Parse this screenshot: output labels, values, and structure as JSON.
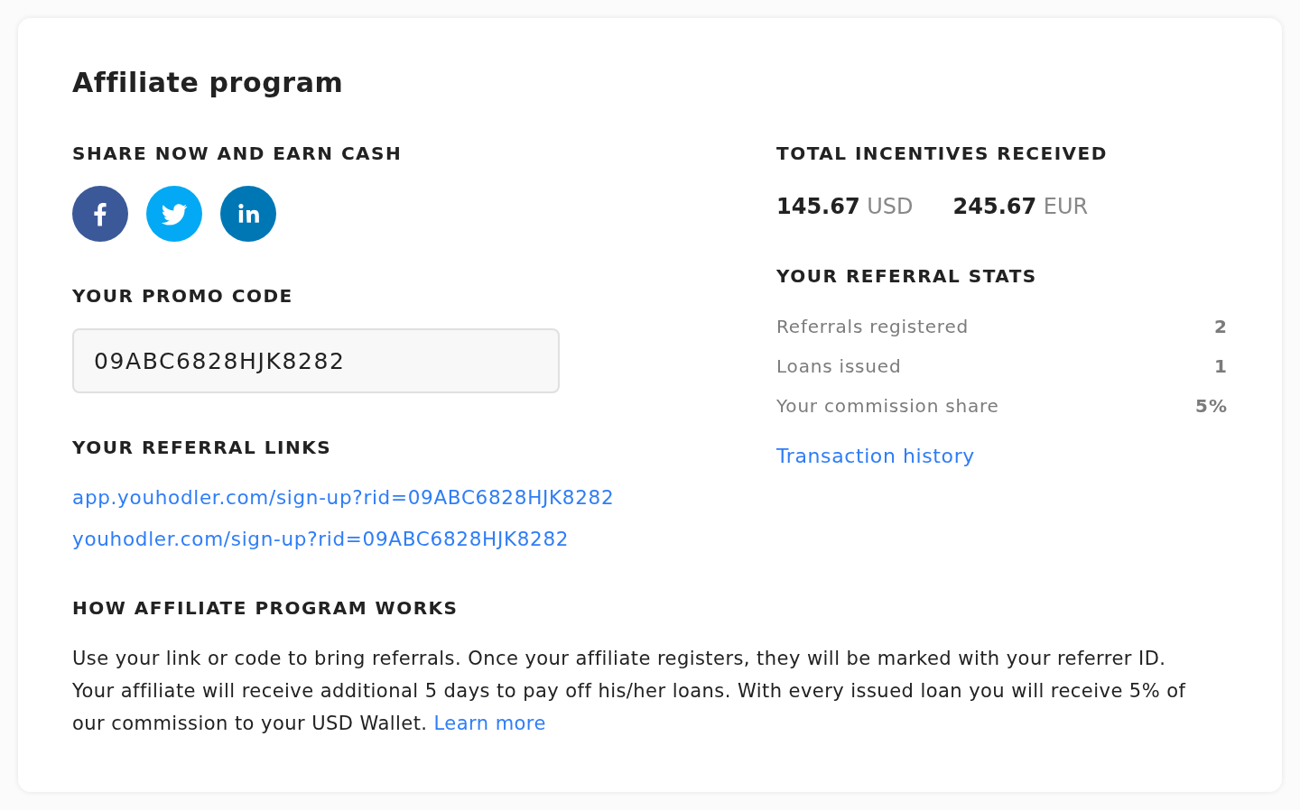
{
  "title": "Affiliate program",
  "share": {
    "heading": "SHARE NOW AND EARN CASH"
  },
  "promo_code": {
    "heading": "YOUR PROMO CODE",
    "value": "09ABC6828HJK8282"
  },
  "referral_links": {
    "heading": "YOUR REFERRAL LINKS",
    "links": [
      "app.youhodler.com/sign-up?rid=09ABC6828HJK8282",
      "youhodler.com/sign-up?rid=09ABC6828HJK8282"
    ]
  },
  "incentives": {
    "heading": "TOTAL INCENTIVES RECEIVED",
    "amounts": [
      {
        "value": "145.67",
        "currency": "USD"
      },
      {
        "value": "245.67",
        "currency": "EUR"
      }
    ]
  },
  "stats": {
    "heading": "YOUR REFERRAL STATS",
    "rows": [
      {
        "label": "Referrals registered",
        "value": "2"
      },
      {
        "label": "Loans issued",
        "value": "1"
      },
      {
        "label": "Your commission share",
        "value": "5%"
      }
    ],
    "history_link": "Transaction history"
  },
  "how_it_works": {
    "heading": "HOW AFFILIATE PROGRAM WORKS",
    "lines": [
      "Use your link or code to bring referrals. Once your affiliate registers, they will be marked with your referrer ID.",
      "Your affiliate will receive additional 5 days to pay off his/her loans. With every issued loan you will receive 5% of",
      "our commission to your USD Wallet."
    ],
    "link": "Learn more"
  }
}
